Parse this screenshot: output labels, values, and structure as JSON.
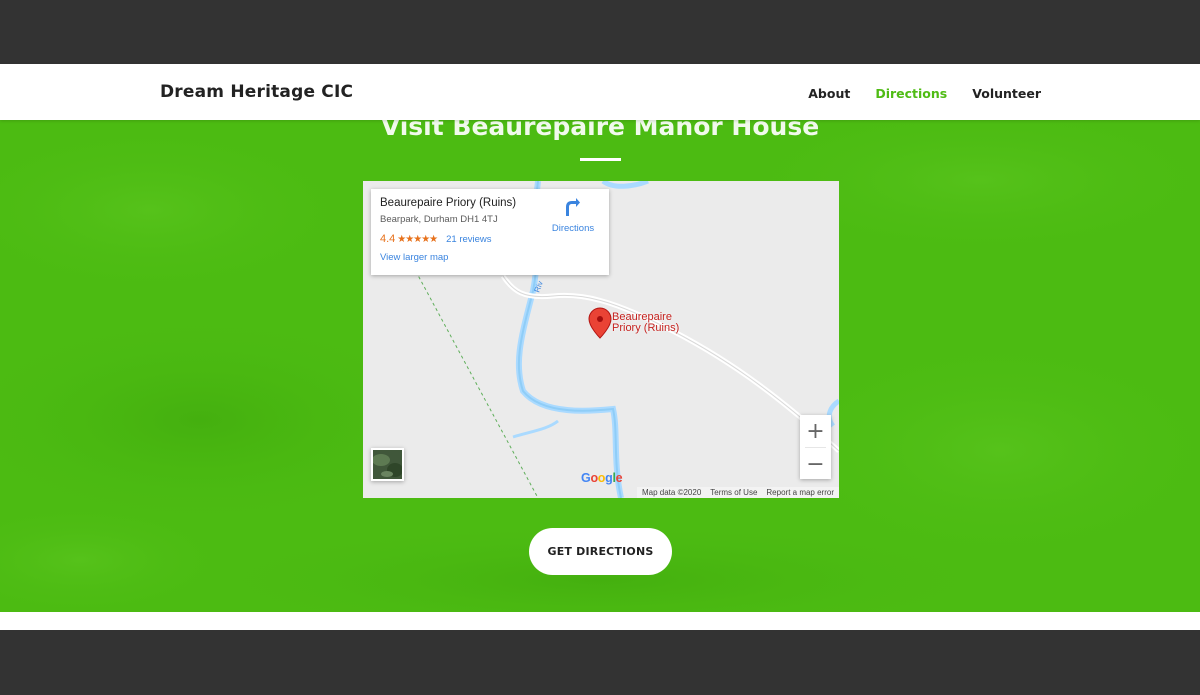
{
  "brand": "Dream Heritage CIC",
  "nav": [
    {
      "label": "About",
      "active": false
    },
    {
      "label": "Directions",
      "active": true
    },
    {
      "label": "Volunteer",
      "active": false
    }
  ],
  "hero": {
    "title": "Visit Beaurepaire Manor House",
    "cta": "GET DIRECTIONS"
  },
  "map": {
    "place_name": "Beaurepaire Priory (Ruins)",
    "address": "Bearpark, Durham DH1 4TJ",
    "rating": "4.4",
    "stars": "★★★★★",
    "reviews": "21 reviews",
    "view_larger": "View larger map",
    "directions_label": "Directions",
    "pin_label_line1": "Beaurepaire",
    "pin_label_line2": "Priory (Ruins)",
    "road_label": "Riv",
    "zoom_in": "+",
    "zoom_out": "−",
    "logo": "Google",
    "map_data": "Map data ©2020",
    "terms": "Terms of Use",
    "report": "Report a map error"
  },
  "colors": {
    "accent_green": "#4cbb12",
    "link_blue": "#3a84df",
    "rating_orange": "#e7711b",
    "pin_red": "#ea4335"
  }
}
